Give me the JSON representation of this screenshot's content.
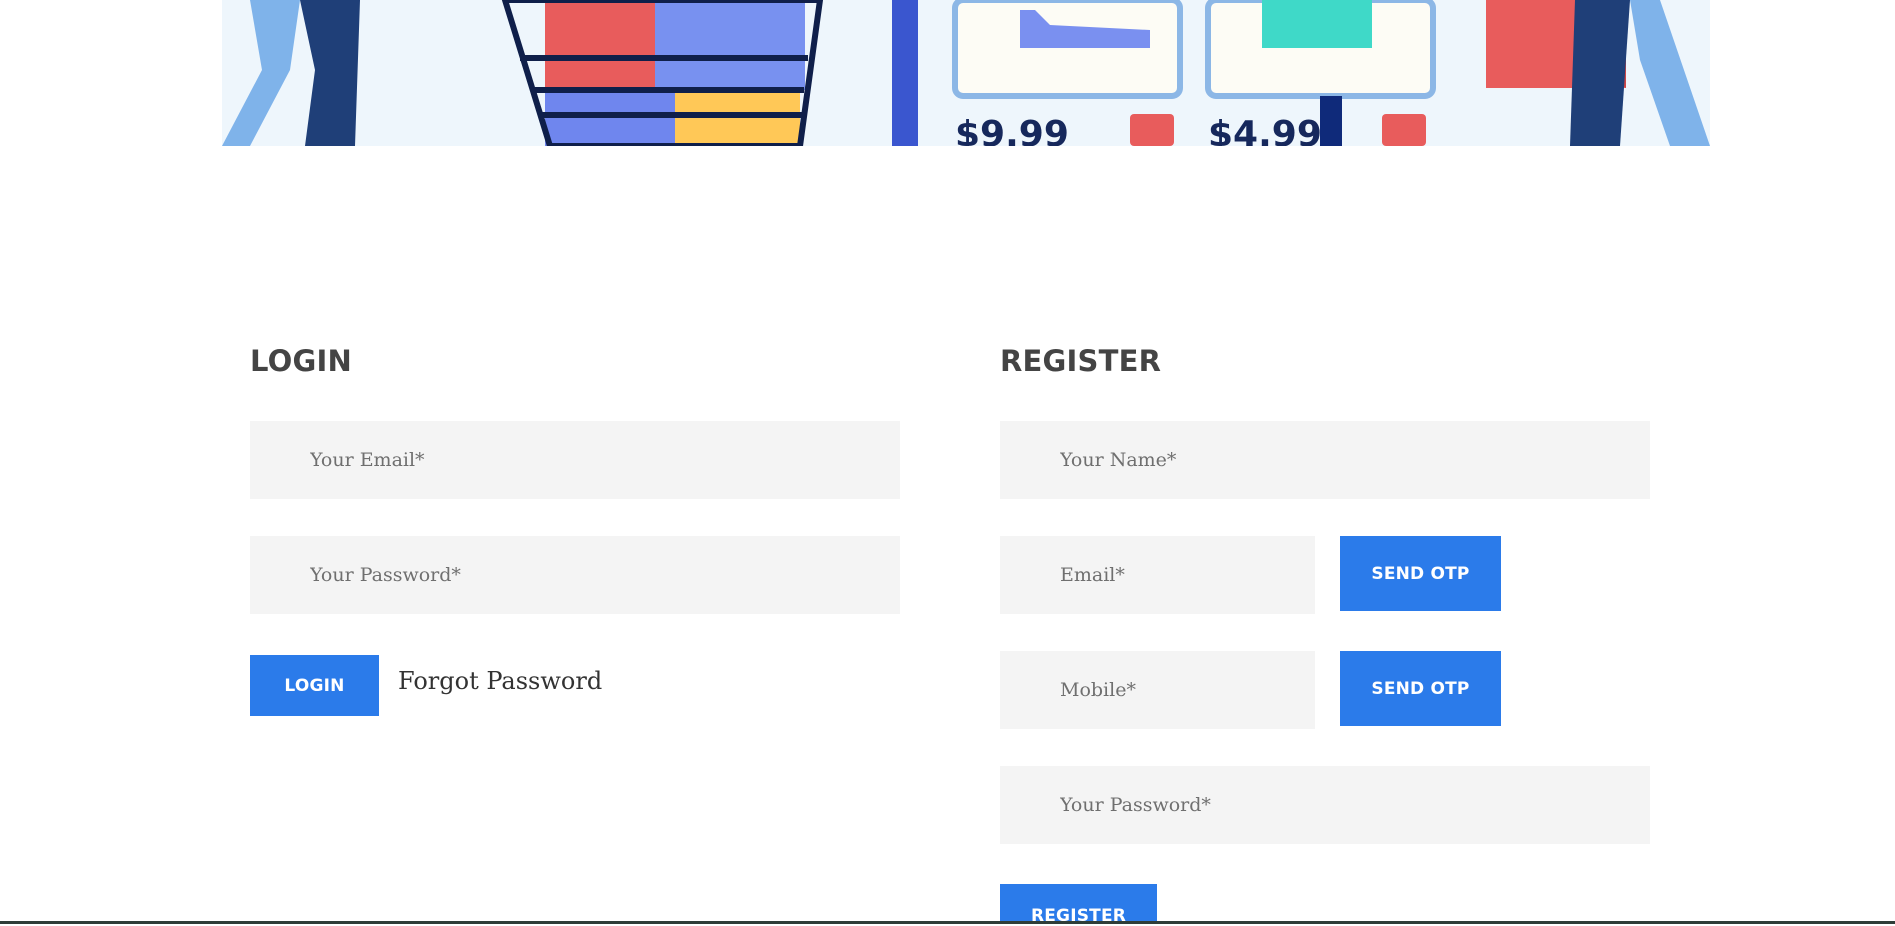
{
  "banner": {
    "price_left": "$9.99",
    "price_right": "$4.99"
  },
  "login": {
    "title": "LOGIN",
    "email_placeholder": "Your Email*",
    "password_placeholder": "Your Password*",
    "login_label": "LOGIN",
    "forgot_label": "Forgot Password"
  },
  "register": {
    "title": "REGISTER",
    "name_placeholder": "Your Name*",
    "email_placeholder": "Email*",
    "mobile_placeholder": "Mobile*",
    "send_otp_email_label": "SEND OTP",
    "send_otp_mobile_label": "SEND OTP",
    "password_placeholder": "Your Password*",
    "register_label": "REGISTER"
  },
  "colors": {
    "accent": "#2b7bea",
    "field_bg": "#f4f4f4",
    "heading": "#444444"
  }
}
